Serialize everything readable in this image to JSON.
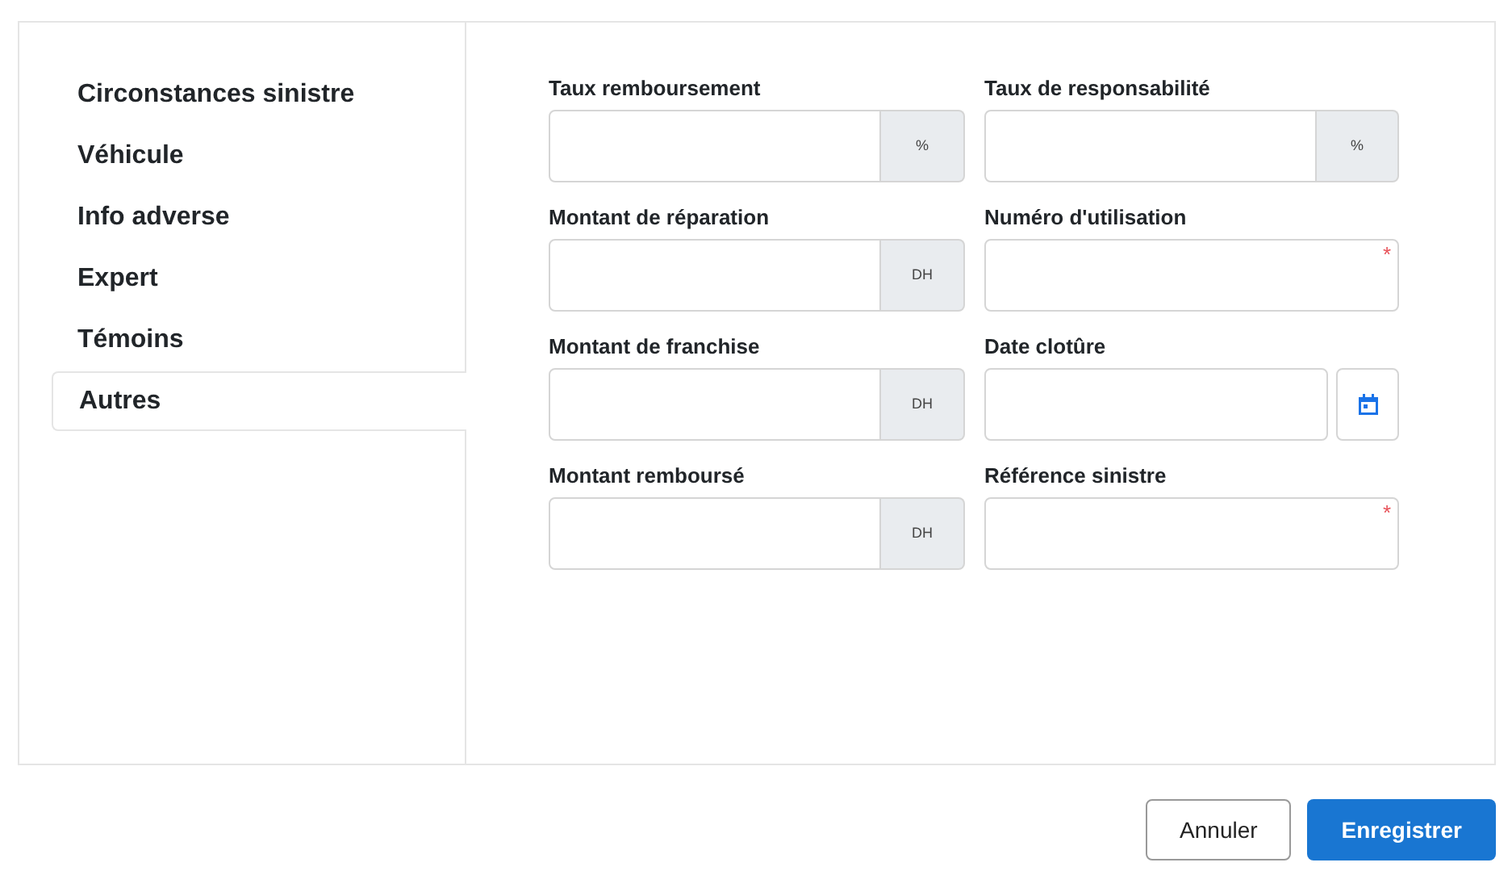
{
  "sidebar": {
    "items": [
      {
        "label": "Circonstances sinistre",
        "selected": false
      },
      {
        "label": "Véhicule",
        "selected": false
      },
      {
        "label": "Info adverse",
        "selected": false
      },
      {
        "label": "Expert",
        "selected": false
      },
      {
        "label": "Témoins",
        "selected": false
      },
      {
        "label": "Autres",
        "selected": true
      }
    ]
  },
  "fields": [
    {
      "label": "Taux remboursement",
      "kind": "addon",
      "addon": "%"
    },
    {
      "label": "Taux de responsabilité",
      "kind": "addon",
      "addon": "%"
    },
    {
      "label": "Montant de réparation",
      "kind": "addon",
      "addon": "DH"
    },
    {
      "label": "Numéro d'utilisation",
      "kind": "required",
      "required_mark": "*"
    },
    {
      "label": "Montant de franchise",
      "kind": "addon",
      "addon": "DH"
    },
    {
      "label": "Date clotûre",
      "kind": "date"
    },
    {
      "label": "Montant remboursé",
      "kind": "addon",
      "addon": "DH"
    },
    {
      "label": "Référence sinistre",
      "kind": "required",
      "required_mark": "*"
    }
  ],
  "buttons": [
    {
      "label": "Annuler",
      "kind": "secondary"
    },
    {
      "label": "Enregistrer",
      "kind": "primary"
    }
  ]
}
